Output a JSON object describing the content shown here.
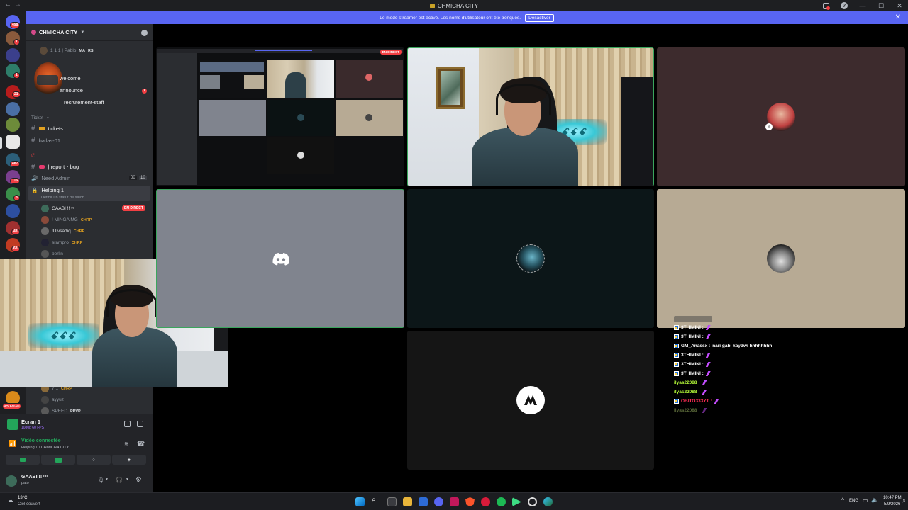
{
  "window": {
    "title": "CHMICHA CITY"
  },
  "banner": {
    "text": "Le mode streamer est activé. Les noms d'utilisateur ont été tronqués.",
    "button": "Désactiver"
  },
  "rail_badges": {
    "top": "498",
    "b1": "1",
    "b2": "1",
    "b3": "21",
    "b4": "1",
    "b5": "1",
    "b6": "487",
    "b7": "116",
    "b8": "8",
    "b9": "43",
    "b10": "68",
    "new": "NOUVEAU"
  },
  "server": {
    "name": "CHMICHA CITY"
  },
  "sidebar": {
    "top_user": "1 1 1 | Pablo",
    "top_user_tag1": "MA",
    "top_user_tag2": "RS",
    "ch_welcome": "welcome",
    "ch_announce": "announce",
    "ch_announce_badge": "1",
    "ch_recrutement": "recrutement-staff",
    "category_ticket": "Ticket",
    "ch_tickets": "tickets",
    "ch_ballas": "ballas-01",
    "ch_report": "| report・bug",
    "ch_need_admin": "Need Admin",
    "need_admin_count1": "00",
    "need_admin_count2": "10",
    "ch_helping": "Helping 1",
    "helping_status": "Définir un statut de salon",
    "voice_users": [
      {
        "name": "GAABI !! ᵒᵒ",
        "tag": "",
        "live": "EN DIRECT"
      },
      {
        "name": "! MINGA MG",
        "tag": "CHRP"
      },
      {
        "name": "!Ulvsadiq",
        "tag": "CHRP"
      },
      {
        "name": "srampro",
        "tag": "CHRP"
      },
      {
        "name": "berlin",
        "tag": ""
      }
    ],
    "lower_users": [
      {
        "name": "7...",
        "tag": "CHRP"
      },
      {
        "name": "ayyuz",
        "tag": ""
      },
      {
        "name": "SPEED",
        "tag": "PPVP"
      }
    ]
  },
  "stream_panel": {
    "title": "Écran 1",
    "sub": "1080p 60 FPS"
  },
  "voice_panel": {
    "status": "Vidéo connectée",
    "channel": "Helping 1 / CHMICHA CITY"
  },
  "user_panel": {
    "name": "GAABI !! ᵒᵒ",
    "status": "pato"
  },
  "mini_stream": {
    "live": "EN DIRECT"
  },
  "chat": [
    {
      "user": "3THIMINI :",
      "msg": "",
      "color": "#ffffff",
      "icon": true,
      "sword": true
    },
    {
      "user": "3THIMINI :",
      "msg": "",
      "color": "#ffffff",
      "icon": true,
      "sword": true
    },
    {
      "user": "GM_Anassx :",
      "msg": "nari gabi kaydwi hhhhhhhh",
      "color": "#ffffff",
      "icon": true,
      "sword": false
    },
    {
      "user": "3THIMINI :",
      "msg": "",
      "color": "#ffffff",
      "icon": true,
      "sword": true
    },
    {
      "user": "3THIMINI :",
      "msg": "",
      "color": "#ffffff",
      "icon": true,
      "sword": true
    },
    {
      "user": "3THIMINI :",
      "msg": "",
      "color": "#ffffff",
      "icon": true,
      "sword": true
    },
    {
      "user": "ilyas22088 :",
      "msg": "",
      "color": "#b8ff3a",
      "icon": false,
      "sword": true
    },
    {
      "user": "ilyas22088 :",
      "msg": "",
      "color": "#b8ff3a",
      "icon": false,
      "sword": true
    },
    {
      "user": "OBITO333YT :",
      "msg": "",
      "color": "#ff2d55",
      "icon": true,
      "sword": true
    },
    {
      "user": "ilyas22088 :",
      "msg": "",
      "color": "#5c6b3a",
      "icon": false,
      "sword": true
    }
  ],
  "weather": {
    "temp": "13°C",
    "desc": "Ciel couvert"
  },
  "clock": {
    "time": "10:47 PM",
    "date": "5/9/2026"
  },
  "lang": "ENG",
  "colors": {
    "accent": "#5865f2",
    "live": "#f23f43",
    "green": "#23a55a"
  }
}
